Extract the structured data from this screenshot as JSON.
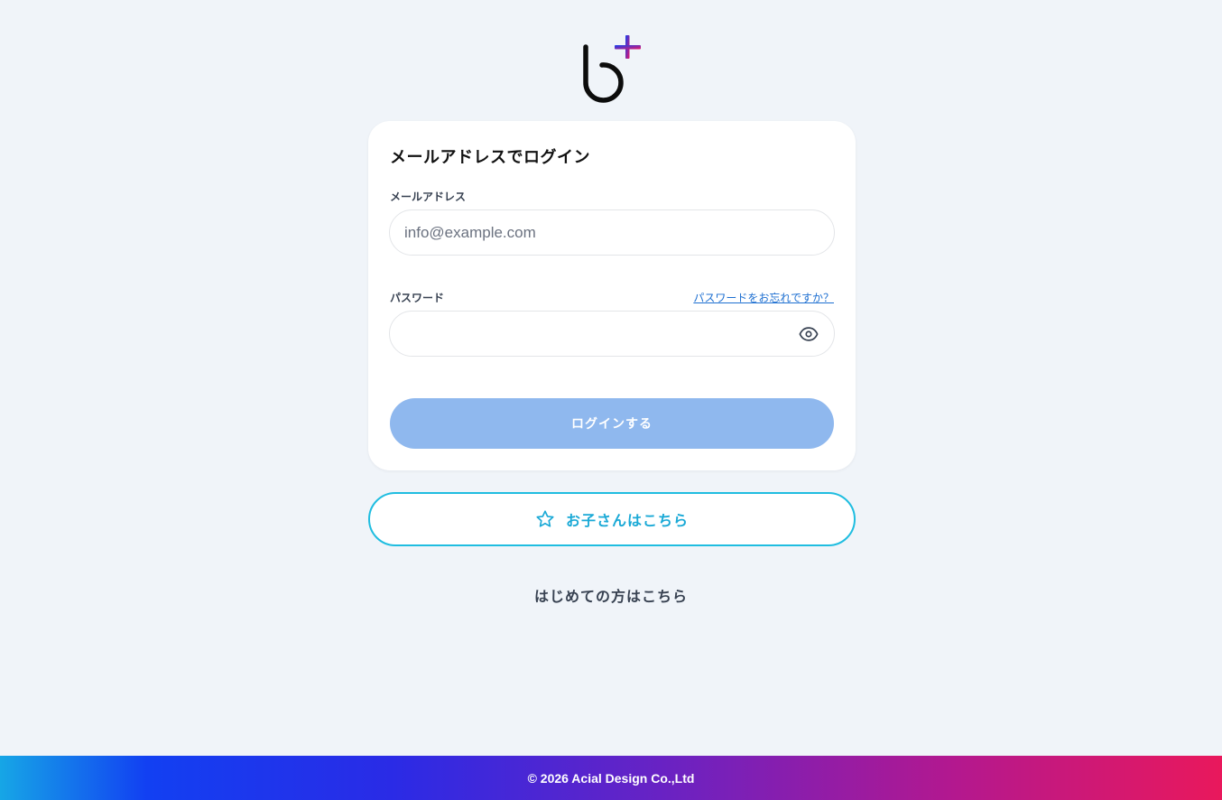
{
  "brand": {
    "logo_icon": "b-plus-logo",
    "logo_accent_colors": [
      "#1440f0",
      "#e5166c"
    ]
  },
  "login_card": {
    "title": "メールアドレスでログイン",
    "email": {
      "label": "メールアドレス",
      "placeholder": "info@example.com",
      "value": ""
    },
    "password": {
      "label": "パスワード",
      "forgot_link": "パスワードをお忘れですか？",
      "value": "",
      "toggle_icon": "eye-icon"
    },
    "submit_label": "ログインする",
    "submit_color": "#8fb8ee"
  },
  "child_login": {
    "label": "お子さんはこちら",
    "icon": "star-icon",
    "accent_color": "#1fbde0"
  },
  "first_time_link": "はじめての方はこちら",
  "footer": {
    "copyright": "© 2026 Acial Design Co.,Ltd"
  }
}
